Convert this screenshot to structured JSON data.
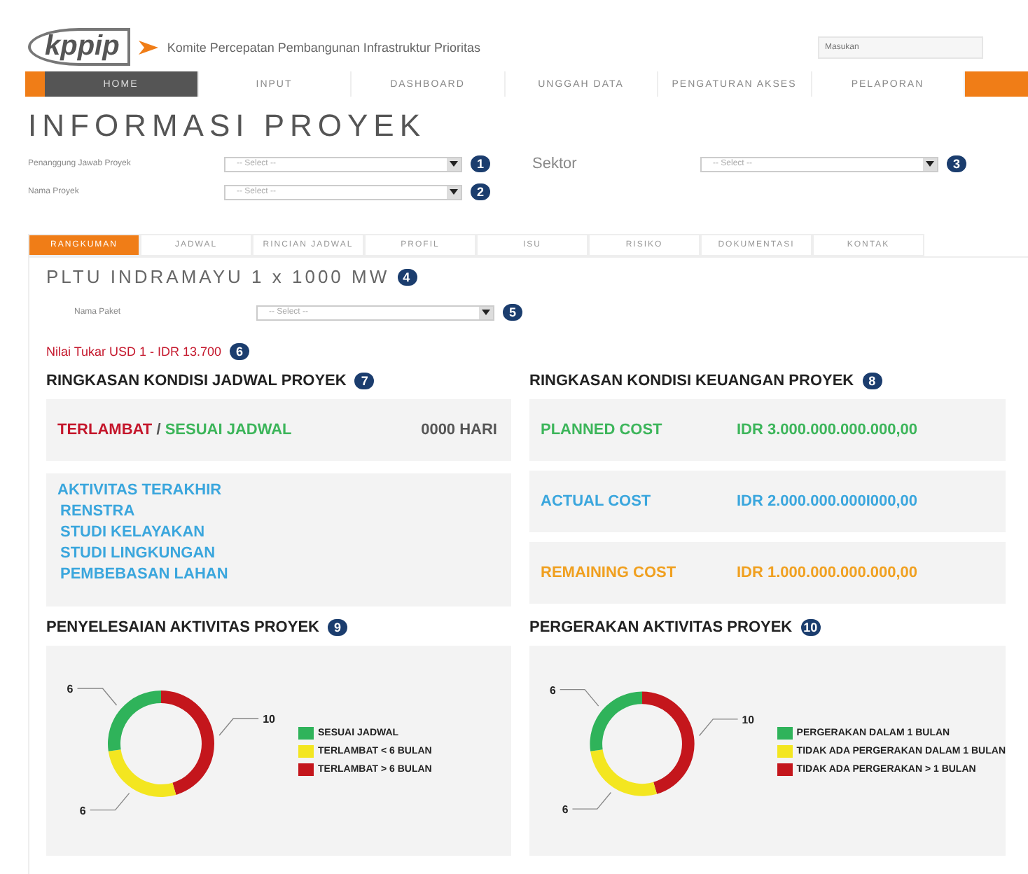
{
  "header": {
    "logo": "kppip",
    "org_name": "Komite Percepatan Pembangunan Infrastruktur Prioritas",
    "search": {
      "placeholder": "Masukan"
    }
  },
  "nav": [
    {
      "label": "HOME",
      "selected": true
    },
    {
      "label": "INPUT",
      "selected": false
    },
    {
      "label": "DASHBOARD",
      "selected": false
    },
    {
      "label": "UNGGAH DATA",
      "selected": false
    },
    {
      "label": "PENGATURAN AKSES",
      "selected": false
    },
    {
      "label": "PELAPORAN",
      "selected": false
    }
  ],
  "page_title": "INFORMASI PROYEK",
  "filters": [
    {
      "label": "Penanggung Jawab Proyek",
      "placeholder": "-- Select --",
      "badge": "1"
    },
    {
      "label": "Nama Proyek",
      "placeholder": "-- Select --",
      "badge": "2"
    }
  ],
  "sector_filter": {
    "label": "Sektor",
    "placeholder": "-- Select --",
    "badge": "3"
  },
  "tabs": [
    {
      "label": "RANGKUMAN",
      "selected": true
    },
    {
      "label": "JADWAL",
      "selected": false
    },
    {
      "label": "RINCIAN JADWAL",
      "selected": false
    },
    {
      "label": "PROFIL",
      "selected": false
    },
    {
      "label": "ISU",
      "selected": false
    },
    {
      "label": "RISIKO",
      "selected": false
    },
    {
      "label": "DOKUMENTASI",
      "selected": false
    },
    {
      "label": "KONTAK",
      "selected": false
    }
  ],
  "project": {
    "title": "PLTU INDRAMAYU 1 x 1000 MW",
    "badge": "4"
  },
  "package_filter": {
    "label": "Nama Paket",
    "placeholder": "-- Select --",
    "badge": "5"
  },
  "exchange_rate": {
    "text": "Nilai Tukar USD 1 - IDR 13.700",
    "badge": "6"
  },
  "schedule_summary": {
    "title": "RINGKASAN KONDISI JADWAL PROYEK",
    "badge": "7",
    "status_late": "TERLAMBAT",
    "separator": "/",
    "status_ontime": "SESUAI JADWAL",
    "days": "0000 HARI",
    "activities_title": "AKTIVITAS TERAKHIR",
    "activities": [
      "RENSTRA",
      "STUDI KELAYAKAN",
      "STUDI LINGKUNGAN",
      "PEMBEBASAN LAHAN"
    ]
  },
  "finance_summary": {
    "title": "RINGKASAN KONDISI KEUANGAN PROYEK",
    "badge": "8",
    "rows": [
      {
        "label": "PLANNED COST",
        "value": "IDR 3.000.000.000.000,00",
        "color": "#3cb55a"
      },
      {
        "label": "ACTUAL COST",
        "value": "IDR 2.000.000.000I000,00",
        "color": "#3aa6dd"
      },
      {
        "label": "REMAINING COST",
        "value": "IDR 1.000.000.000.000,00",
        "color": "#f0a020"
      }
    ]
  },
  "charts": [
    {
      "title": "PENYELESAIAN AKTIVITAS PROYEK",
      "badge": "9",
      "chart_data": {
        "type": "donut",
        "categories": [
          "SESUAI JADWAL",
          "TERLAMBAT < 6 BULAN",
          "TERLAMBAT > 6 BULAN"
        ],
        "values": [
          6,
          6,
          10
        ],
        "colors": [
          "#2fb35a",
          "#f3e620",
          "#c4161c"
        ],
        "data_labels": true
      }
    },
    {
      "title": "PERGERAKAN AKTIVITAS PROYEK",
      "badge": "10",
      "chart_data": {
        "type": "donut",
        "categories": [
          "PERGERAKAN DALAM 1 BULAN",
          "TIDAK ADA PERGERAKAN DALAM 1 BULAN",
          "TIDAK ADA PERGERAKAN > 1 BULAN"
        ],
        "values": [
          6,
          6,
          10
        ],
        "colors": [
          "#2fb35a",
          "#f3e620",
          "#c4161c"
        ],
        "data_labels": true
      }
    }
  ]
}
